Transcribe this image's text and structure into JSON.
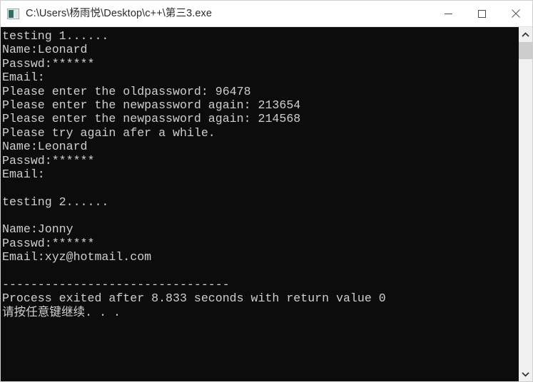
{
  "window": {
    "title": "C:\\Users\\杨雨悦\\Desktop\\c++\\第三3.exe",
    "icon": "console-window-icon",
    "background_color": "#0c0c0c",
    "text_color": "#cfcfcf",
    "titlebar_color": "#ffffff"
  },
  "controls": {
    "minimize": {
      "name": "minimize-button",
      "glyph": "minimize-icon"
    },
    "maximize": {
      "name": "maximize-button",
      "glyph": "maximize-icon"
    },
    "close": {
      "name": "close-button",
      "glyph": "close-icon"
    }
  },
  "scrollbar": {
    "up_arrow": "chevron-up-icon",
    "down_arrow": "chevron-down-icon",
    "thumb_position_pct": 0,
    "thumb_size_pct": 5
  },
  "console": {
    "lines": [
      "testing 1......",
      "Name:Leonard",
      "Passwd:******",
      "Email:",
      "Please enter the oldpassword: 96478",
      "Please enter the newpassword again: 213654",
      "Please enter the newpassword again: 214568",
      "Please try again afer a while.",
      "Name:Leonard",
      "Passwd:******",
      "Email:",
      "",
      "testing 2......",
      "",
      "Name:Jonny",
      "Passwd:******",
      "Email:xyz@hotmail.com",
      "",
      "--------------------------------",
      "Process exited after 8.833 seconds with return value 0",
      "请按任意键继续. . .",
      "",
      "",
      "",
      ""
    ]
  }
}
